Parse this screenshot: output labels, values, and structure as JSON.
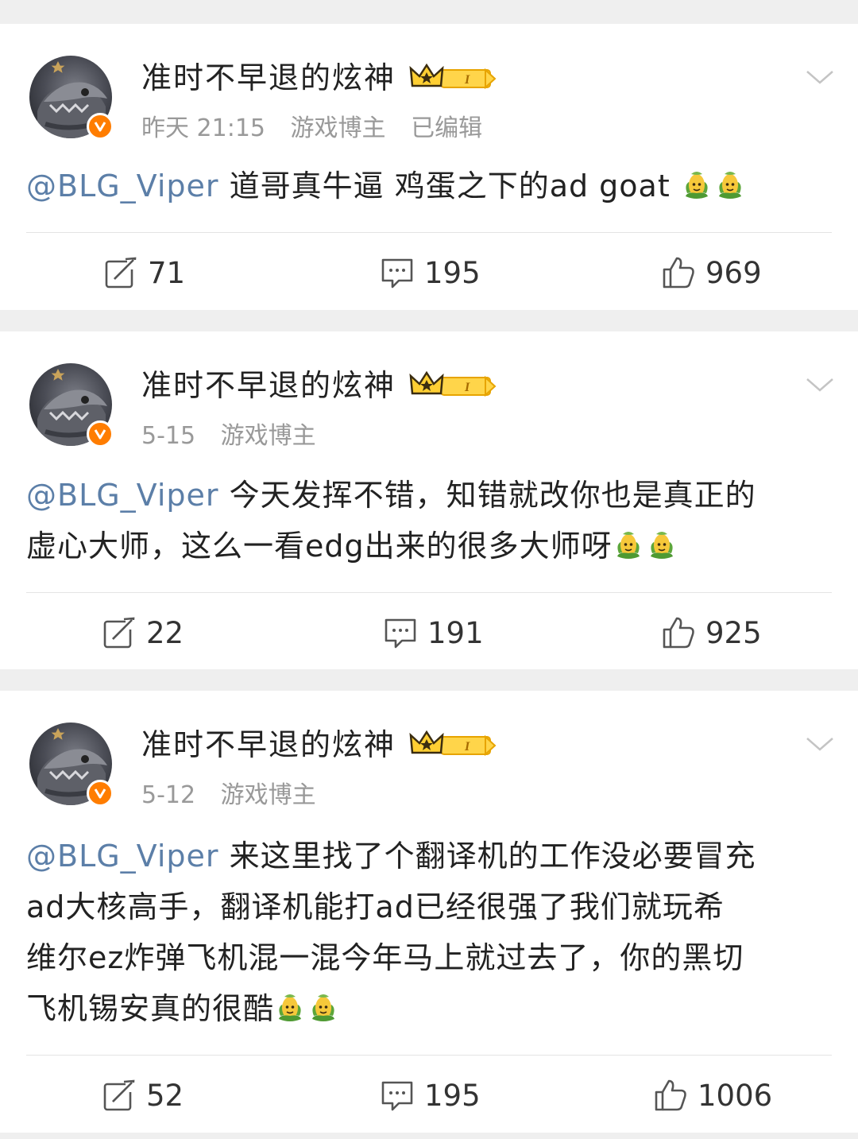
{
  "posts": [
    {
      "username": "准时不早退的炫神",
      "level_badge": "I",
      "time": "昨天 21:15",
      "tag": "游戏博主",
      "edited": "已编辑",
      "mention": "@BLG_Viper",
      "lines": [
        " 道哥真牛逼 鸡蛋之下的ad goat "
      ],
      "reposts": "71",
      "comments": "195",
      "likes": "969"
    },
    {
      "username": "准时不早退的炫神",
      "level_badge": "I",
      "time": "5-15",
      "tag": "游戏博主",
      "mention": "@BLG_Viper",
      "lines": [
        " 今天发挥不错，知错就改你也是真正的",
        "虚心大师，这么一看edg出来的很多大师呀"
      ],
      "reposts": "22",
      "comments": "191",
      "likes": "925"
    },
    {
      "username": "准时不早退的炫神",
      "level_badge": "I",
      "time": "5-12",
      "tag": "游戏博主",
      "mention": "@BLG_Viper",
      "lines": [
        " 来这里找了个翻译机的工作没必要冒充",
        "ad大核高手，翻译机能打ad已经很强了我们就玩希",
        "维尔ez炸弹飞机混一混今年马上就过去了，你的黑切",
        "飞机锡安真的很酷"
      ],
      "reposts": "52",
      "comments": "195",
      "likes": "1006"
    }
  ],
  "colors": {
    "mention": "#5c7fa8",
    "verified": "#ff7d00",
    "badge_gold": "#f5b400",
    "meta": "#999999"
  },
  "icons": [
    "avatar",
    "verified-icon",
    "crown-icon",
    "chevron-down-icon",
    "repost-icon",
    "comment-icon",
    "like-icon",
    "corn-emoji-icon"
  ]
}
